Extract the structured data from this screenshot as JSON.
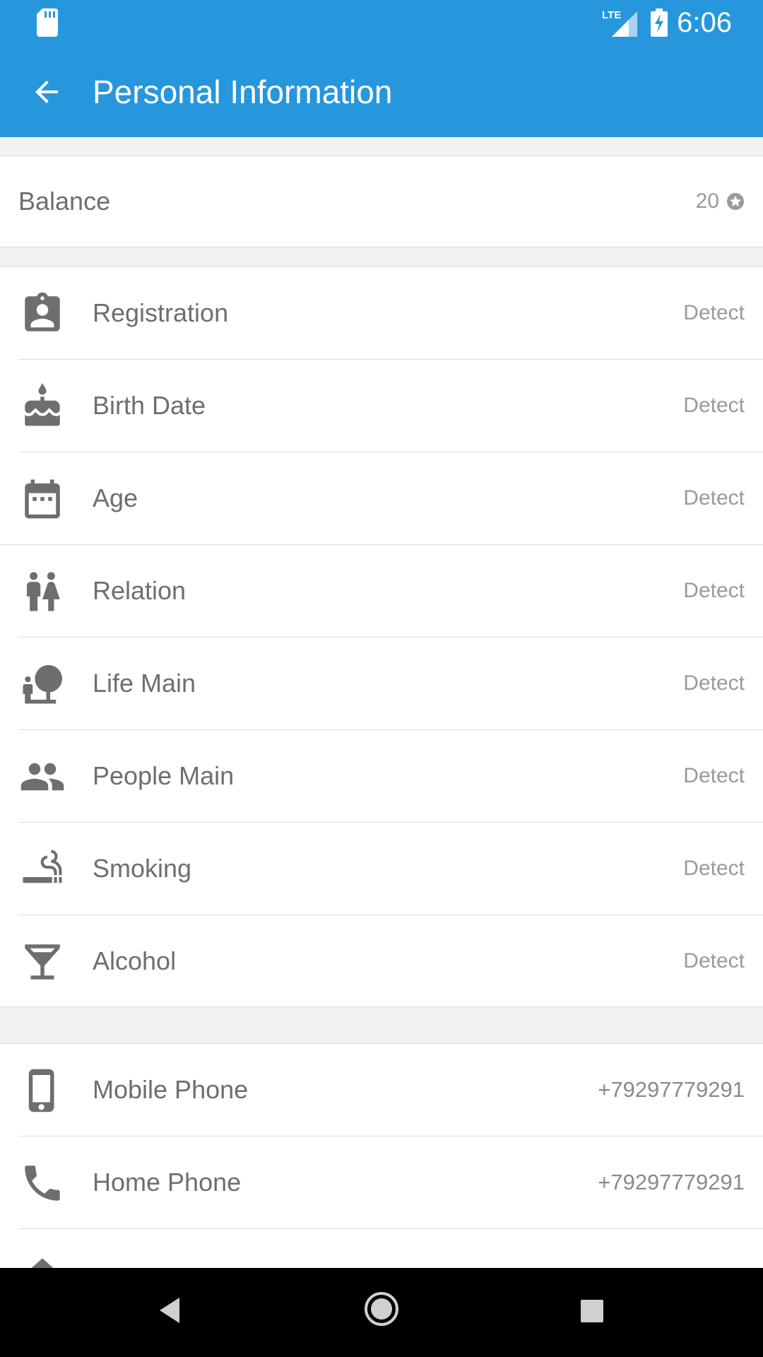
{
  "status_bar": {
    "time": "6:06",
    "network_label": "LTE",
    "icons": [
      "sd-card-icon",
      "lte-signal-icon",
      "battery-charging-icon"
    ]
  },
  "toolbar": {
    "title": "Personal Information",
    "back_icon": "arrow-back-icon",
    "background_color": "#2697dd"
  },
  "balance": {
    "label": "Balance",
    "value": "20",
    "icon": "star-coin-icon"
  },
  "details": [
    {
      "label": "Registration",
      "value": "Detect",
      "icon": "contact-badge-icon"
    },
    {
      "label": "Birth Date",
      "value": "Detect",
      "icon": "cake-icon"
    },
    {
      "label": "Age",
      "value": "Detect",
      "icon": "calendar-icon"
    },
    {
      "label": "Relation",
      "value": "Detect",
      "icon": "wc-couple-icon"
    },
    {
      "label": "Life Main",
      "value": "Detect",
      "icon": "nature-people-icon"
    },
    {
      "label": "People Main",
      "value": "Detect",
      "icon": "people-group-icon"
    },
    {
      "label": "Smoking",
      "value": "Detect",
      "icon": "smoking-icon"
    },
    {
      "label": "Alcohol",
      "value": "Detect",
      "icon": "cocktail-glass-icon"
    }
  ],
  "contacts": [
    {
      "label": "Mobile Phone",
      "value": "+79297779291",
      "icon": "smartphone-icon"
    },
    {
      "label": "Home Phone",
      "value": "+79297779291",
      "icon": "phone-handset-icon"
    }
  ],
  "nav_bar": {
    "icons": [
      "nav-back-icon",
      "nav-home-icon",
      "nav-recents-icon"
    ]
  }
}
